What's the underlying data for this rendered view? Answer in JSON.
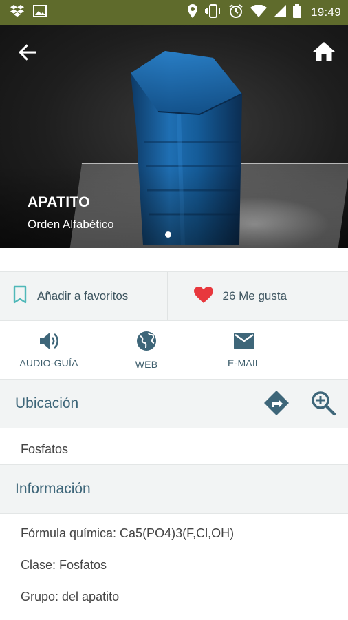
{
  "status_bar": {
    "time": "19:49",
    "left_icons": [
      "dropbox-icon",
      "image-icon"
    ],
    "right_icons": [
      "location-icon",
      "vibrate-icon",
      "alarm-icon",
      "wifi-icon",
      "signal-icon",
      "battery-icon"
    ]
  },
  "hero": {
    "title": "APATITO",
    "subtitle": "Orden Alfabético",
    "image": "blue-apatite-crystal-photo"
  },
  "favorites": {
    "add_label": "Añadir a favoritos",
    "likes_label": "26 Me gusta"
  },
  "actions": [
    {
      "label": "AUDIO-GUÍA",
      "icon": "speaker-icon"
    },
    {
      "label": "WEB",
      "icon": "globe-icon"
    },
    {
      "label": "E-MAIL",
      "icon": "mail-icon"
    }
  ],
  "location": {
    "title": "Ubicación",
    "value": "Fosfatos"
  },
  "information": {
    "title": "Información",
    "lines": [
      "Fórmula química: Ca5(PO4)3(F,Cl,OH)",
      "Clase: Fosfatos",
      "Grupo: del apatito"
    ]
  },
  "colors": {
    "status_bar": "#5f6b2c",
    "accent_teal": "#3e6679",
    "heart_red": "#e8383d",
    "bookmark_teal": "#4fb8b8"
  }
}
